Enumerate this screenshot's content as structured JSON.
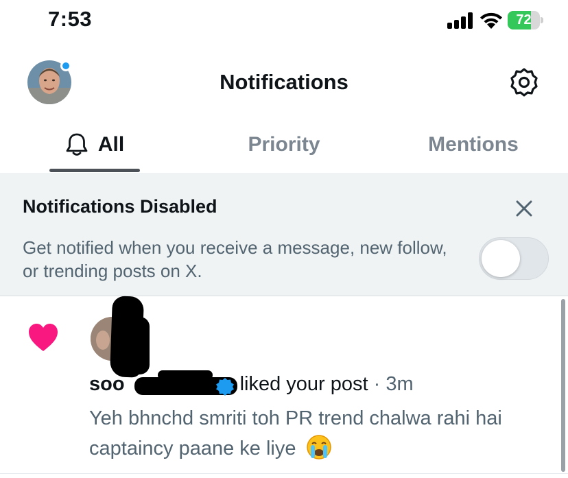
{
  "status_bar": {
    "time": "7:53",
    "battery_level": "72",
    "battery_fraction": 0.72,
    "battery_color": "#34c759"
  },
  "header": {
    "title": "Notifications",
    "avatar_icon": "profile-avatar",
    "settings_icon": "gear-icon",
    "unread_dot_color": "#1d9bf0"
  },
  "tabs": [
    {
      "label": "All",
      "active": true,
      "icon": "bell-icon"
    },
    {
      "label": "Priority",
      "active": false
    },
    {
      "label": "Mentions",
      "active": false
    }
  ],
  "banner": {
    "title": "Notifications Disabled",
    "body": "Get notified when you receive a message, new follow, or trending posts on X.",
    "close_icon": "close-icon",
    "toggle_on": false
  },
  "notification": {
    "type_icon": "heart-icon",
    "type_color": "#f91880",
    "user_visible": "soo",
    "verified_icon": "verified-badge-icon",
    "action": "liked your post",
    "separator": "·",
    "time": "3m",
    "post_text": "Yeh bhnchd smriti toh PR trend chalwa rahi hai captaincy paane ke liye",
    "emoji": "loudly-crying-face"
  }
}
